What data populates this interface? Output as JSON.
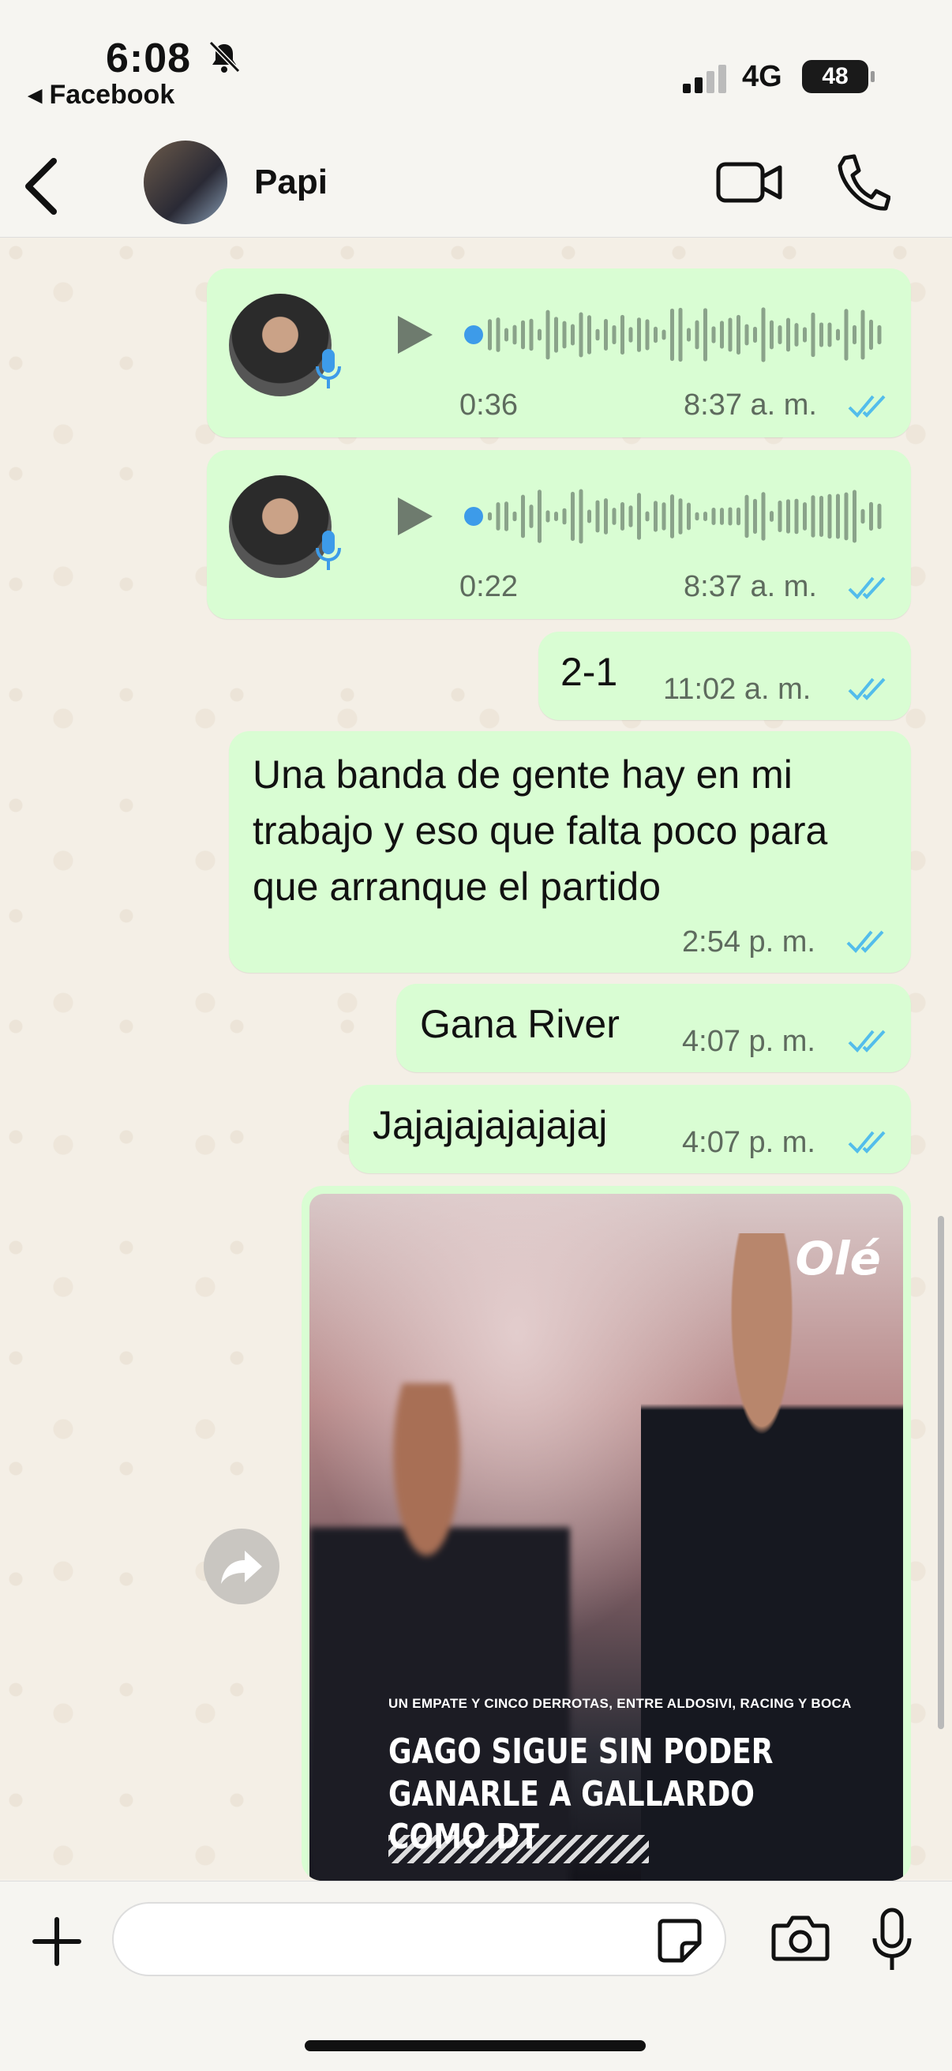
{
  "status_bar": {
    "time": "6:08",
    "back_app": "◂ Facebook",
    "network": "4G",
    "battery": "48"
  },
  "header": {
    "contact_name": "Papi"
  },
  "messages": [
    {
      "type": "voice",
      "duration": "0:36",
      "time": "8:37 a. m."
    },
    {
      "type": "voice",
      "duration": "0:22",
      "time": "8:37 a. m."
    },
    {
      "type": "text",
      "text": "2-1",
      "time": "11:02 a. m."
    },
    {
      "type": "text",
      "text": "Una banda de gente hay en mi trabajo y eso que falta poco para que arranque el partido",
      "time": "2:54 p. m."
    },
    {
      "type": "text",
      "text": "Gana River",
      "time": "4:07 p. m."
    },
    {
      "type": "text",
      "text": "Jajajajajajajaj",
      "time": "4:07 p. m."
    }
  ],
  "image_message": {
    "logo": "Olé",
    "kicker": "UN EMPATE Y CINCO DERROTAS, ENTRE ALDOSIVI, RACING Y BOCA",
    "headline": "GAGO SIGUE SIN PODER GANARLE A GALLARDO COMO DT"
  },
  "composer": {
    "placeholder": ""
  },
  "colors": {
    "bubble_out": "#d9fdd3",
    "ticks": "#53bdeb",
    "wave": "#8aa38a",
    "dot": "#3d9be9"
  },
  "icons": [
    "back-chevron-icon",
    "video-call-icon",
    "phone-icon",
    "play-icon",
    "mic-icon",
    "forward-icon",
    "plus-icon",
    "sticker-icon",
    "camera-icon",
    "microphone-icon",
    "read-ticks-icon",
    "bell-muted-icon",
    "signal-icon"
  ]
}
